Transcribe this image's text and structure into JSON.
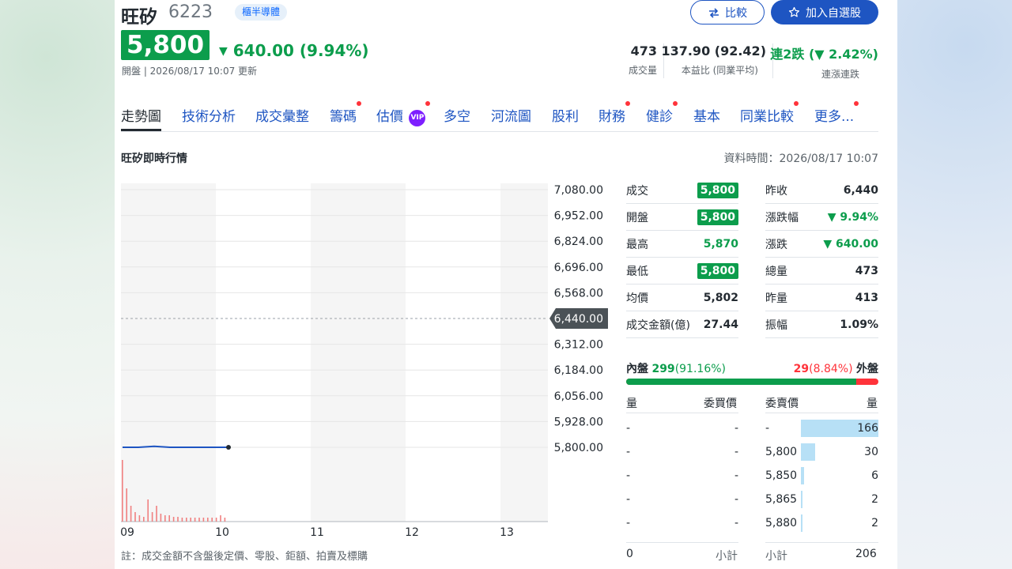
{
  "header": {
    "name": "旺矽",
    "code": "6223",
    "tag": "櫃半導體",
    "compare_label": "比較",
    "add_label": "加入自選股",
    "price": "5,800",
    "change": "640.00 (9.94%)",
    "update_time": "開盤 | 2026/08/17 10:07 更新"
  },
  "stats": [
    {
      "value": "473",
      "label": "成交量"
    },
    {
      "value": "137.90 (92.42)",
      "label": "本益比 (同業平均)"
    },
    {
      "value": "連2跌 (▼ 2.42%)",
      "label": "連漲連跌"
    }
  ],
  "tabs": [
    {
      "label": "走勢圖",
      "active": true,
      "dot": false
    },
    {
      "label": "技術分析",
      "dot": false
    },
    {
      "label": "成交彙整",
      "dot": false
    },
    {
      "label": "籌碼",
      "dot": true
    },
    {
      "label": "估價",
      "dot": true,
      "vip": "VIP"
    },
    {
      "label": "多空",
      "dot": false
    },
    {
      "label": "河流圖",
      "dot": false
    },
    {
      "label": "股利",
      "dot": false
    },
    {
      "label": "財務",
      "dot": true
    },
    {
      "label": "健診",
      "dot": true
    },
    {
      "label": "基本",
      "dot": false
    },
    {
      "label": "同業比較",
      "dot": true
    },
    {
      "label": "更多...",
      "dot": true
    }
  ],
  "section": {
    "title": "旺矽即時行情",
    "data_time": "資料時間：2026/08/17 10:07"
  },
  "chart_data": {
    "type": "line",
    "y_ticks": [
      "7,080.00",
      "6,952.00",
      "6,824.00",
      "6,696.00",
      "6,568.00",
      "6,440.00",
      "6,312.00",
      "6,184.00",
      "6,056.00",
      "5,928.00",
      "5,800.00"
    ],
    "ylim": [
      5800,
      7080
    ],
    "reference_price": "6,440.00",
    "x_ticks": [
      "09",
      "10",
      "11",
      "12",
      "13"
    ],
    "price_series": {
      "x": [
        "09:00",
        "09:10",
        "09:20",
        "09:30",
        "09:40",
        "09:50",
        "10:00",
        "10:07"
      ],
      "y": [
        5800,
        5800,
        5805,
        5800,
        5800,
        5800,
        5800,
        5800
      ]
    },
    "volume_series": {
      "values": [
        78,
        42,
        20,
        12,
        8,
        6,
        28,
        12,
        20,
        10,
        8,
        8,
        6,
        6,
        5,
        5,
        5,
        5,
        5,
        5,
        5,
        5,
        5,
        8,
        5
      ]
    }
  },
  "quote": {
    "left": [
      {
        "label": "成交",
        "value": "5,800",
        "style": "box"
      },
      {
        "label": "開盤",
        "value": "5,800",
        "style": "box"
      },
      {
        "label": "最高",
        "value": "5,870",
        "style": "green"
      },
      {
        "label": "最低",
        "value": "5,800",
        "style": "box"
      },
      {
        "label": "均價",
        "value": "5,802",
        "style": ""
      },
      {
        "label": "成交金額(億)",
        "value": "27.44",
        "style": ""
      }
    ],
    "right": [
      {
        "label": "昨收",
        "value": "6,440",
        "style": ""
      },
      {
        "label": "漲跌幅",
        "value": "▼ 9.94%",
        "style": "green"
      },
      {
        "label": "漲跌",
        "value": "▼ 640.00",
        "style": "green"
      },
      {
        "label": "總量",
        "value": "473",
        "style": ""
      },
      {
        "label": "昨量",
        "value": "413",
        "style": ""
      },
      {
        "label": "振幅",
        "value": "1.09%",
        "style": ""
      }
    ]
  },
  "inout": {
    "in_label": "內盤",
    "in_value": "299",
    "in_pct": "(91.16%)",
    "out_value": "29",
    "out_pct": "(8.84%)",
    "out_label": "外盤",
    "in_fraction": 0.9116
  },
  "orderbook": {
    "headers": {
      "bid_vol": "量",
      "bid_price": "委買價",
      "ask_price": "委賣價",
      "ask_vol": "量"
    },
    "rows": [
      {
        "bid_vol": "-",
        "bid_price": "-",
        "ask_price": "-",
        "ask_vol": "166",
        "ask_num": 166
      },
      {
        "bid_vol": "-",
        "bid_price": "-",
        "ask_price": "5,800",
        "ask_vol": "30",
        "ask_num": 30
      },
      {
        "bid_vol": "-",
        "bid_price": "-",
        "ask_price": "5,850",
        "ask_vol": "6",
        "ask_num": 6
      },
      {
        "bid_vol": "-",
        "bid_price": "-",
        "ask_price": "5,865",
        "ask_vol": "2",
        "ask_num": 2
      },
      {
        "bid_vol": "-",
        "bid_price": "-",
        "ask_price": "5,880",
        "ask_vol": "2",
        "ask_num": 2
      }
    ],
    "bid_total": "0",
    "bid_total_label": "小計",
    "ask_total_label": "小計",
    "ask_total": "206"
  },
  "note": "註：成交金額不含盤後定價、零股、鉅額、拍賣及標購",
  "colors": {
    "green": "#0c9d4c",
    "red": "#ff333a",
    "blue": "#1e55c2",
    "line": "#1e55c2"
  }
}
